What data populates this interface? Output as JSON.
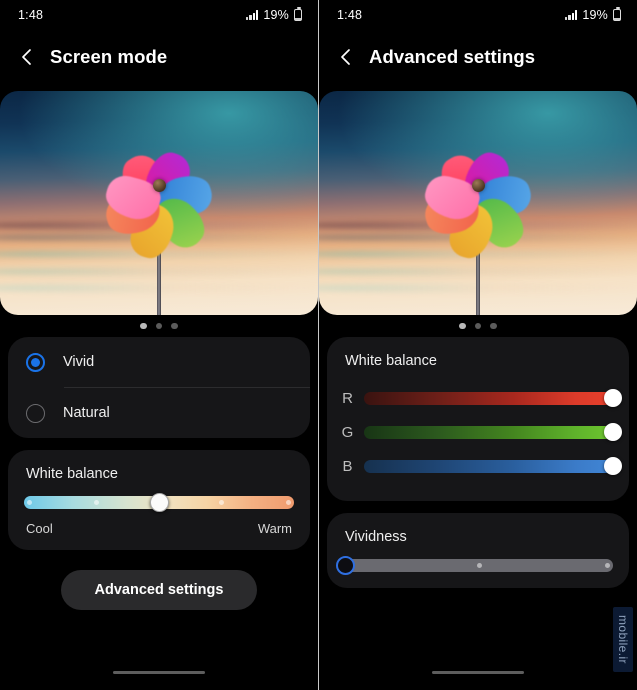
{
  "status_bar": {
    "time": "1:48",
    "battery_percent": "19%",
    "signal_icon": "signal-bars-icon",
    "battery_icon": "battery-icon"
  },
  "left_panel": {
    "title": "Screen mode",
    "back_icon": "chevron-left-icon",
    "preview": {
      "image_name": "pinwheel-wallpaper-preview",
      "dots_total": 3,
      "dots_active_index": 0
    },
    "modes": [
      {
        "label": "Vivid",
        "selected": true
      },
      {
        "label": "Natural",
        "selected": false
      }
    ],
    "white_balance": {
      "title": "White balance",
      "cool_label": "Cool",
      "warm_label": "Warm",
      "value_percent": 50,
      "tick_percents": [
        2,
        27,
        73,
        98
      ],
      "gradient_cool": "#6ec9e8",
      "gradient_warm": "#f09b6e"
    },
    "advanced_button_label": "Advanced settings"
  },
  "right_panel": {
    "title": "Advanced settings",
    "back_icon": "chevron-left-icon",
    "preview": {
      "image_name": "pinwheel-wallpaper-preview",
      "dots_total": 3,
      "dots_active_index": 0
    },
    "white_balance": {
      "title": "White balance",
      "channels": [
        {
          "letter": "R",
          "value_percent": 100,
          "color": "#e8402c"
        },
        {
          "letter": "G",
          "value_percent": 100,
          "color": "#6ec62f"
        },
        {
          "letter": "B",
          "value_percent": 100,
          "color": "#4186d6"
        }
      ]
    },
    "vividness": {
      "title": "Vividness",
      "value_percent": 0,
      "tick_percents": [
        50,
        98
      ],
      "track_color": "#6a6a70",
      "thumb_ring_color": "#2f6fe0"
    }
  },
  "watermark": {
    "text": "mobile.ir"
  },
  "theme": {
    "background": "#000000",
    "card": "#161618",
    "accent": "#1a73e8",
    "text_primary": "#ffffff",
    "text_secondary": "#bdbdbd"
  }
}
